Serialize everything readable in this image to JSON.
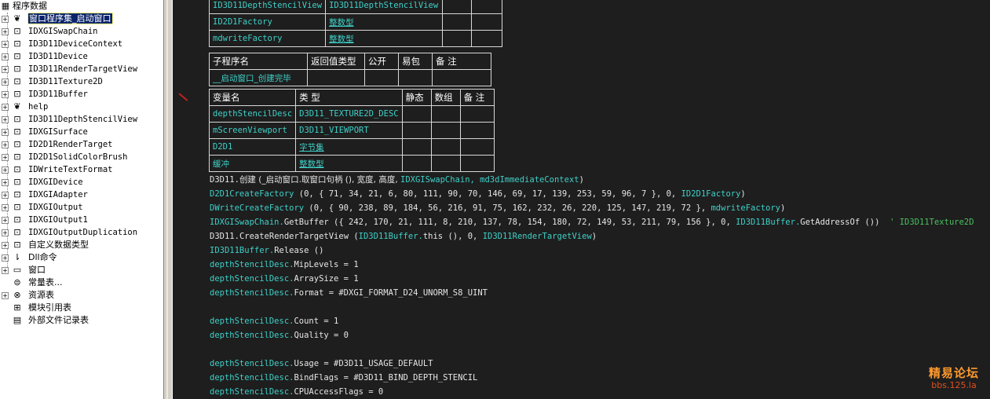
{
  "tree": {
    "root_label": "程序数据",
    "items": [
      {
        "label": "窗口程序集_启动窗口",
        "icon": "class-module-icon",
        "expand": "+",
        "selected": true,
        "cn": true
      },
      {
        "label": "IDXGISwapChain",
        "icon": "class-icon",
        "expand": "+"
      },
      {
        "label": "ID3D11DeviceContext",
        "icon": "class-icon",
        "expand": "+"
      },
      {
        "label": "ID3D11Device",
        "icon": "class-icon",
        "expand": "+"
      },
      {
        "label": "ID3D11RenderTargetView",
        "icon": "class-icon",
        "expand": "+"
      },
      {
        "label": "ID3D11Texture2D",
        "icon": "class-icon",
        "expand": "+"
      },
      {
        "label": "ID3D11Buffer",
        "icon": "class-icon",
        "expand": "+"
      },
      {
        "label": "help",
        "icon": "module-icon",
        "expand": "+"
      },
      {
        "label": "ID3D11DepthStencilView",
        "icon": "class-icon",
        "expand": "+"
      },
      {
        "label": "IDXGISurface",
        "icon": "class-icon",
        "expand": "+"
      },
      {
        "label": "ID2D1RenderTarget",
        "icon": "class-icon",
        "expand": "+"
      },
      {
        "label": "ID2D1SolidColorBrush",
        "icon": "class-icon",
        "expand": "+"
      },
      {
        "label": "IDWriteTextFormat",
        "icon": "class-icon",
        "expand": "+"
      },
      {
        "label": "IDXGIDevice",
        "icon": "class-icon",
        "expand": "+"
      },
      {
        "label": "IDXGIAdapter",
        "icon": "class-icon",
        "expand": "+"
      },
      {
        "label": "IDXGIOutput",
        "icon": "class-icon",
        "expand": "+"
      },
      {
        "label": "IDXGIOutput1",
        "icon": "class-icon",
        "expand": "+"
      },
      {
        "label": "IDXGIOutputDuplication",
        "icon": "class-icon",
        "expand": "+"
      },
      {
        "label": "自定义数据类型",
        "icon": "datatype-icon",
        "expand": "+",
        "cn": true
      },
      {
        "label": "Dll命令",
        "icon": "dll-icon",
        "expand": "+",
        "cn": true
      },
      {
        "label": "窗口",
        "icon": "window-icon",
        "expand": "+",
        "cn": true
      },
      {
        "label": "常量表...",
        "icon": "constant-icon",
        "expand": "",
        "cn": true
      },
      {
        "label": "资源表",
        "icon": "resource-icon",
        "expand": "+",
        "cn": true
      },
      {
        "label": "模块引用表",
        "icon": "module-ref-icon",
        "expand": "",
        "cn": true
      },
      {
        "label": "外部文件记录表",
        "icon": "external-file-icon",
        "expand": "",
        "cn": true
      }
    ]
  },
  "top_table": {
    "rows": [
      [
        "ID3D11DepthStencilView",
        "ID3D11DepthStencilView",
        "",
        ""
      ],
      [
        "ID2D1Factory",
        "整数型",
        "",
        ""
      ],
      [
        "mdwriteFactory",
        "整数型",
        "",
        ""
      ]
    ]
  },
  "sub_table": {
    "headers": [
      "子程序名",
      "返回值类型",
      "公开",
      "易包",
      "备 注"
    ],
    "row": [
      "__启动窗口_创建完毕",
      "",
      "",
      "",
      ""
    ]
  },
  "var_table": {
    "headers": [
      "变量名",
      "类 型",
      "静态",
      "数组",
      "备 注"
    ],
    "rows": [
      [
        "depthStencilDesc",
        "D3D11_TEXTURE2D_DESC",
        "",
        "",
        ""
      ],
      [
        "mScreenViewport",
        "D3D11_VIEWPORT",
        "",
        "",
        ""
      ],
      [
        "D2D1",
        "字节集",
        "",
        "",
        ""
      ],
      [
        "缓冲",
        "整数型",
        "",
        "",
        ""
      ]
    ]
  },
  "code_lines": [
    [
      [
        "w",
        "D3D11."
      ],
      [
        "wcn",
        "创建 (_启动窗口.取窗口句柄 (), 宽度, 高度, "
      ],
      [
        "c",
        "IDXGISwapChain, md3dImmediateContext"
      ],
      [
        "w",
        ")"
      ]
    ],
    [
      [
        "c",
        "D2D1CreateFactory"
      ],
      [
        "w",
        " (0, { 71, 34, 21, 6, 80, 111, 90, 70, 146, 69, 17, 139, 253, 59, 96, 7 }, 0, "
      ],
      [
        "c",
        "ID2D1Factory"
      ],
      [
        "w",
        ")"
      ]
    ],
    [
      [
        "c",
        "DWriteCreateFactory"
      ],
      [
        "w",
        " (0, { 90, 238, 89, 184, 56, 216, 91, 75, 162, 232, 26, 220, 125, 147, 219, 72 }, "
      ],
      [
        "c",
        "mdwriteFactory"
      ],
      [
        "w",
        ")"
      ]
    ],
    [
      [
        "c",
        "IDXGISwapChain."
      ],
      [
        "w",
        "GetBuffer ({ 242, 170, 21, 111, 8, 210, 137, 78, 154, 180, 72, 149, 53, 211, 79, 156 }, 0, "
      ],
      [
        "c",
        "ID3D11Buffer."
      ],
      [
        "w",
        "GetAddressOf ())"
      ],
      [
        "g",
        "  ' ID3D11Texture2D"
      ]
    ],
    [
      [
        "w",
        "D3D11."
      ],
      [
        "w",
        "CreateRenderTargetView ("
      ],
      [
        "c",
        "ID3D11Buffer."
      ],
      [
        "w",
        "this (), 0, "
      ],
      [
        "c",
        "ID3D11RenderTargetView"
      ],
      [
        "w",
        ")"
      ]
    ],
    [
      [
        "c",
        "ID3D11Buffer."
      ],
      [
        "w",
        "Release ()"
      ]
    ],
    [
      [
        "c",
        "depthStencilDesc."
      ],
      [
        "w",
        "MipLevels = 1"
      ]
    ],
    [
      [
        "c",
        "depthStencilDesc."
      ],
      [
        "w",
        "ArraySize = 1"
      ]
    ],
    [
      [
        "c",
        "depthStencilDesc."
      ],
      [
        "w",
        "Format = #DXGI_FORMAT_D24_UNORM_S8_UINT"
      ]
    ],
    [],
    [
      [
        "c",
        "depthStencilDesc."
      ],
      [
        "w",
        "Count = 1"
      ]
    ],
    [
      [
        "c",
        "depthStencilDesc."
      ],
      [
        "w",
        "Quality = 0"
      ]
    ],
    [],
    [
      [
        "c",
        "depthStencilDesc."
      ],
      [
        "w",
        "Usage = #D3D11_USAGE_DEFAULT"
      ]
    ],
    [
      [
        "c",
        "depthStencilDesc."
      ],
      [
        "w",
        "BindFlags = #D3D11_BIND_DEPTH_STENCIL"
      ]
    ],
    [
      [
        "c",
        "depthStencilDesc."
      ],
      [
        "w",
        "CPUAccessFlags = 0"
      ]
    ]
  ],
  "watermark": {
    "line1": "精易论坛",
    "line2": "bbs.125.la"
  },
  "colors": {
    "identifier": "#3fd0c8",
    "code_text": "#e6e6e6",
    "comment": "#48c060",
    "background": "#1e1e1e"
  }
}
